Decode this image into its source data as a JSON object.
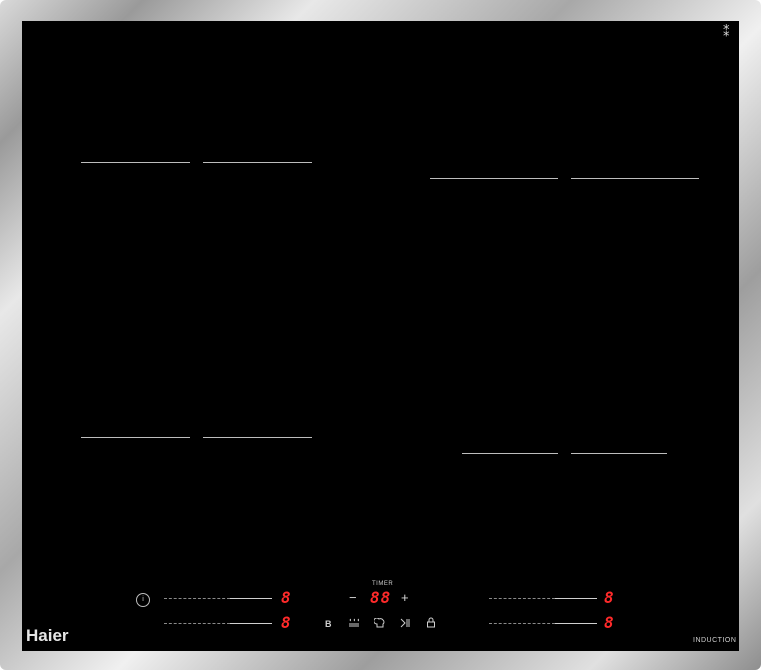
{
  "brand": "Haier",
  "type_label": "INDUCTION",
  "corner_icon": "flex-zone-icon",
  "timer": {
    "label": "TIMER",
    "display": "88",
    "minus": "−",
    "plus": "+"
  },
  "zones": [
    {
      "id": "front-left-row1",
      "display": "8"
    },
    {
      "id": "front-left-row2",
      "display": "8"
    },
    {
      "id": "right-row1",
      "display": "8"
    },
    {
      "id": "right-row2",
      "display": "8"
    }
  ],
  "controls": {
    "power_icon": "power-icon",
    "boost_label": "B",
    "icons": [
      "boost-icon",
      "keep-warm-icon",
      "chef-icon",
      "pause-icon",
      "lock-icon"
    ]
  },
  "colors": {
    "glass": "#000000",
    "display_red": "#ff2a2a",
    "frame": "#b8b8b8"
  }
}
